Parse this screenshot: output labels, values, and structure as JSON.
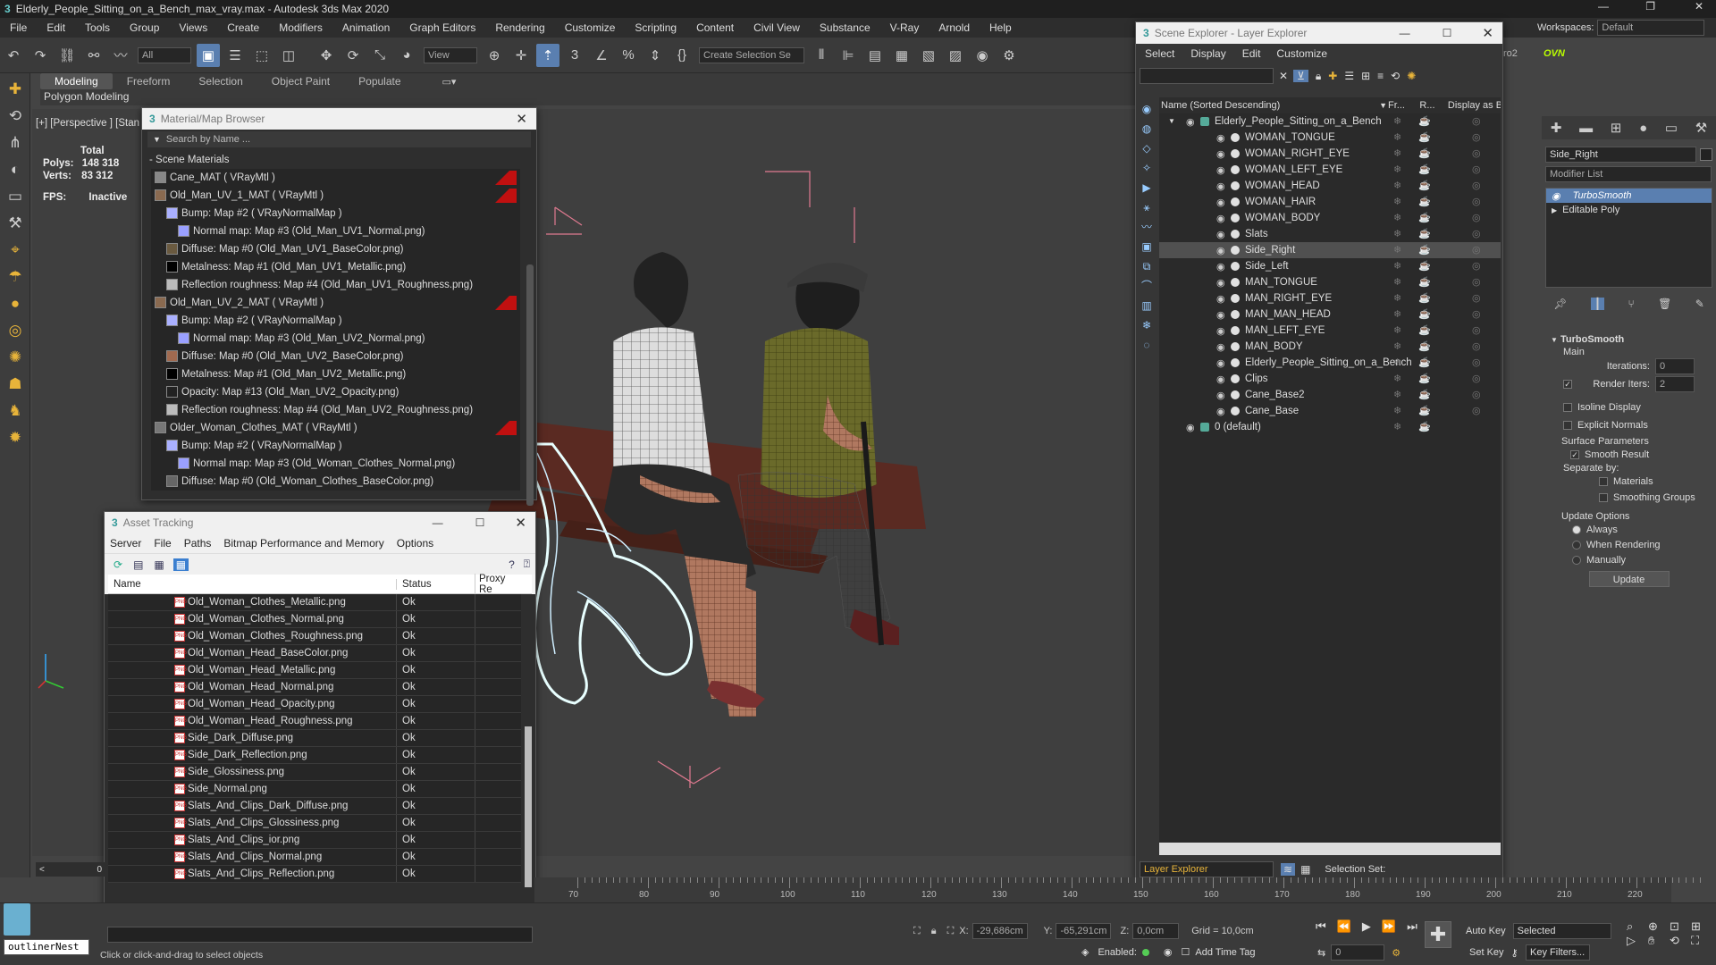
{
  "window": {
    "title": "Elderly_People_Sitting_on_a_Bench_max_vray.max - Autodesk 3ds Max 2020",
    "workspaces_label": "Workspaces:",
    "workspace": "Default"
  },
  "menu": [
    "File",
    "Edit",
    "Tools",
    "Group",
    "Views",
    "Create",
    "Modifiers",
    "Animation",
    "Graph Editors",
    "Rendering",
    "Customize",
    "Scripting",
    "Content",
    "Civil View",
    "Substance",
    "V-Ray",
    "Arnold",
    "Help"
  ],
  "toolbar": {
    "filter": "All",
    "view": "View",
    "selection_set": "Create Selection Se",
    "extra1": "ro2",
    "extra2": "OVN"
  },
  "ribbon": {
    "tabs": [
      "Modeling",
      "Freeform",
      "Selection",
      "Object Paint",
      "Populate"
    ],
    "sub": "Polygon Modeling"
  },
  "viewport": {
    "label": "[+] [Perspective ] [Stan",
    "stats": {
      "total": "Total",
      "polys_label": "Polys:",
      "polys": "148 318",
      "verts_label": "Verts:",
      "verts": "83 312",
      "fps_label": "FPS:",
      "fps": "Inactive"
    }
  },
  "material_browser": {
    "title": "Material/Map Browser",
    "search": "Search by Name ...",
    "section": "- Scene Materials",
    "items": [
      {
        "t": "Cane_MAT  ( VRayMtl )",
        "lvl": 0,
        "tag": true,
        "c": "#888"
      },
      {
        "t": "Old_Man_UV_1_MAT  ( VRayMtl )",
        "lvl": 0,
        "tag": true,
        "c": "#8a6a50"
      },
      {
        "t": "Bump: Map #2  ( VRayNormalMap )",
        "lvl": 1,
        "tag": false,
        "c": "#aab0ff"
      },
      {
        "t": "Normal map: Map #3 (Old_Man_UV1_Normal.png)",
        "lvl": 2,
        "tag": false,
        "c": "#9aa0ff"
      },
      {
        "t": "Diffuse: Map #0 (Old_Man_UV1_BaseColor.png)",
        "lvl": 1,
        "tag": false,
        "c": "#6a5a40"
      },
      {
        "t": "Metalness: Map #1 (Old_Man_UV1_Metallic.png)",
        "lvl": 1,
        "tag": false,
        "c": "#000"
      },
      {
        "t": "Reflection roughness: Map #4 (Old_Man_UV1_Roughness.png)",
        "lvl": 1,
        "tag": false,
        "c": "#bbb"
      },
      {
        "t": "Old_Man_UV_2_MAT  ( VRayMtl )",
        "lvl": 0,
        "tag": true,
        "c": "#8a6a50"
      },
      {
        "t": "Bump: Map #2  ( VRayNormalMap )",
        "lvl": 1,
        "tag": false,
        "c": "#aab0ff"
      },
      {
        "t": "Normal map: Map #3 (Old_Man_UV2_Normal.png)",
        "lvl": 2,
        "tag": false,
        "c": "#9aa0ff"
      },
      {
        "t": "Diffuse: Map #0 (Old_Man_UV2_BaseColor.png)",
        "lvl": 1,
        "tag": false,
        "c": "#a06a50"
      },
      {
        "t": "Metalness: Map #1 (Old_Man_UV2_Metallic.png)",
        "lvl": 1,
        "tag": false,
        "c": "#000"
      },
      {
        "t": "Opacity: Map #13 (Old_Man_UV2_Opacity.png)",
        "lvl": 1,
        "tag": false,
        "c": "#222"
      },
      {
        "t": "Reflection roughness: Map #4 (Old_Man_UV2_Roughness.png)",
        "lvl": 1,
        "tag": false,
        "c": "#bbb"
      },
      {
        "t": "Older_Woman_Clothes_MAT  ( VRayMtl )",
        "lvl": 0,
        "tag": true,
        "c": "#777"
      },
      {
        "t": "Bump: Map #2  ( VRayNormalMap )",
        "lvl": 1,
        "tag": false,
        "c": "#aab0ff"
      },
      {
        "t": "Normal map: Map #3 (Old_Woman_Clothes_Normal.png)",
        "lvl": 2,
        "tag": false,
        "c": "#9aa0ff"
      },
      {
        "t": "Diffuse: Map #0 (Old_Woman_Clothes_BaseColor.png)",
        "lvl": 1,
        "tag": false,
        "c": "#666"
      }
    ]
  },
  "asset_tracking": {
    "title": "Asset Tracking",
    "menu": [
      "Server",
      "File",
      "Paths",
      "Bitmap Performance and Memory",
      "Options"
    ],
    "cols": {
      "name": "Name",
      "status": "Status",
      "proxy": "Proxy Re"
    },
    "png": "PNG",
    "rows": [
      {
        "n": "Old_Woman_Clothes_Metallic.png",
        "s": "Ok"
      },
      {
        "n": "Old_Woman_Clothes_Normal.png",
        "s": "Ok"
      },
      {
        "n": "Old_Woman_Clothes_Roughness.png",
        "s": "Ok"
      },
      {
        "n": "Old_Woman_Head_BaseColor.png",
        "s": "Ok"
      },
      {
        "n": "Old_Woman_Head_Metallic.png",
        "s": "Ok"
      },
      {
        "n": "Old_Woman_Head_Normal.png",
        "s": "Ok"
      },
      {
        "n": "Old_Woman_Head_Opacity.png",
        "s": "Ok"
      },
      {
        "n": "Old_Woman_Head_Roughness.png",
        "s": "Ok"
      },
      {
        "n": "Side_Dark_Diffuse.png",
        "s": "Ok"
      },
      {
        "n": "Side_Dark_Reflection.png",
        "s": "Ok"
      },
      {
        "n": "Side_Glossiness.png",
        "s": "Ok"
      },
      {
        "n": "Side_Normal.png",
        "s": "Ok"
      },
      {
        "n": "Slats_And_Clips_Dark_Diffuse.png",
        "s": "Ok"
      },
      {
        "n": "Slats_And_Clips_Glossiness.png",
        "s": "Ok"
      },
      {
        "n": "Slats_And_Clips_ior.png",
        "s": "Ok"
      },
      {
        "n": "Slats_And_Clips_Normal.png",
        "s": "Ok"
      },
      {
        "n": "Slats_And_Clips_Reflection.png",
        "s": "Ok"
      }
    ]
  },
  "scene_explorer": {
    "title": "Scene Explorer - Layer Explorer",
    "menu": [
      "Select",
      "Display",
      "Edit",
      "Customize"
    ],
    "cols": {
      "name": "Name (Sorted Descending)",
      "fr": "Fr...",
      "r": "R...",
      "disp": "Display as Bo"
    },
    "root": "Elderly_People_Sitting_on_a_Bench",
    "items": [
      "WOMAN_TONGUE",
      "WOMAN_RIGHT_EYE",
      "WOMAN_LEFT_EYE",
      "WOMAN_HEAD",
      "WOMAN_HAIR",
      "WOMAN_BODY",
      "Slats",
      "Side_Right",
      "Side_Left",
      "MAN_TONGUE",
      "MAN_RIGHT_EYE",
      "MAN_MAN_HEAD",
      "MAN_LEFT_EYE",
      "MAN_BODY",
      "Elderly_People_Sitting_on_a_Bench",
      "Clips",
      "Cane_Base2",
      "Cane_Base"
    ],
    "selected": "Side_Right",
    "default_layer": "0 (default)",
    "footer": "Layer Explorer",
    "selection_set": "Selection Set:"
  },
  "command_panel": {
    "object_name": "Side_Right",
    "modifier_list": "Modifier List",
    "stack": [
      "TurboSmooth",
      "Editable Poly"
    ],
    "rollout": "TurboSmooth",
    "main": "Main",
    "iterations_label": "Iterations:",
    "iterations": "0",
    "render_iters_label": "Render Iters:",
    "render_iters": "2",
    "isoline": "Isoline Display",
    "explicit": "Explicit Normals",
    "surface": "Surface Parameters",
    "smooth": "Smooth Result",
    "separate": "Separate by:",
    "materials": "Materials",
    "smoothing": "Smoothing Groups",
    "update_opts": "Update Options",
    "always": "Always",
    "when_rendering": "When Rendering",
    "manually": "Manually",
    "update": "Update"
  },
  "timeline": {
    "ticks": [
      "70",
      "80",
      "90",
      "100",
      "110",
      "120",
      "130",
      "140",
      "150",
      "160",
      "170",
      "180",
      "190",
      "200",
      "210",
      "220"
    ],
    "frame": "0"
  },
  "status": {
    "listener": "outlinerNest",
    "prompt": "Click or click-and-drag to select objects",
    "x_label": "X:",
    "x": "-29,686cm",
    "y_label": "Y:",
    "y": "-65,291cm",
    "z_label": "Z:",
    "z": "0,0cm",
    "grid": "Grid = 10,0cm",
    "enabled": "Enabled:",
    "add_time_tag": "Add Time Tag",
    "auto_key": "Auto Key",
    "set_key": "Set Key",
    "selected": "Selected",
    "key_filters": "Key Filters...",
    "frame": "0"
  }
}
